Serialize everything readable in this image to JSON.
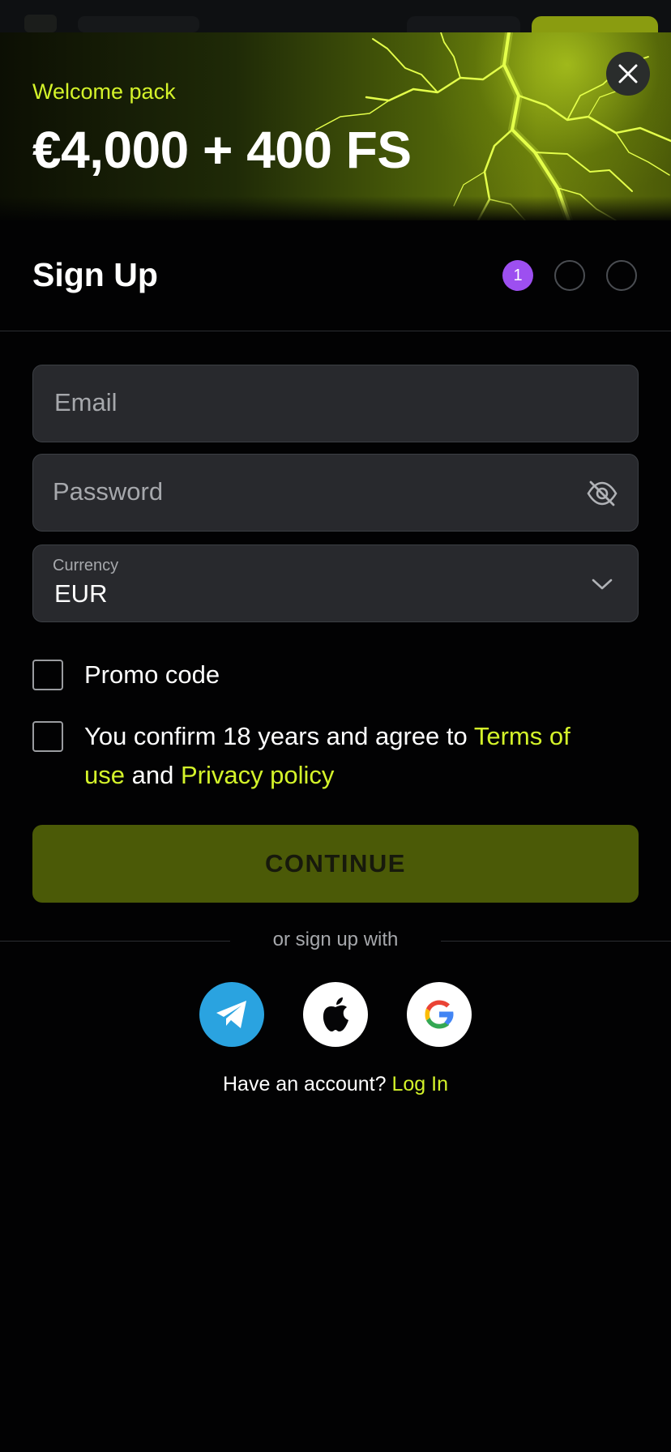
{
  "banner": {
    "welcome_label": "Welcome pack",
    "bonus_text": "€4,000 + 400 FS"
  },
  "header": {
    "title": "Sign Up",
    "steps": [
      "1",
      "",
      ""
    ],
    "active_step": 1
  },
  "form": {
    "email": {
      "placeholder": "Email",
      "value": ""
    },
    "password": {
      "placeholder": "Password",
      "value": ""
    },
    "currency": {
      "label": "Currency",
      "value": "EUR"
    },
    "promo_label": "Promo code",
    "terms": {
      "text_before": "You confirm 18 years and agree to ",
      "terms_link": "Terms of use",
      "text_mid": " and ",
      "privacy_link": "Privacy policy"
    },
    "continue_label": "CONTINUE"
  },
  "social": {
    "label": "or sign up with",
    "providers": [
      "telegram",
      "apple",
      "google"
    ]
  },
  "footer": {
    "question": "Have an account? ",
    "login_link": "Log In"
  },
  "colors": {
    "accent": "#d4f32a",
    "step_active": "#9d4ff0",
    "button_disabled": "#4b5a07",
    "telegram": "#2aa3e0"
  }
}
